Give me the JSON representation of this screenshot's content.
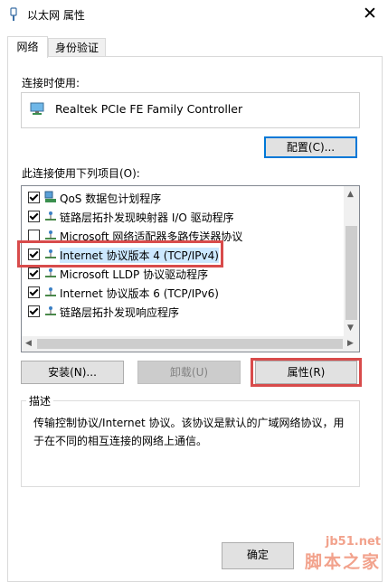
{
  "window": {
    "title": "以太网 属性",
    "close_label": "✕"
  },
  "tabs": [
    {
      "label": "网络",
      "active": true
    },
    {
      "label": "身份验证",
      "active": false
    }
  ],
  "connect_using": {
    "label": "连接时使用:",
    "device_name": "Realtek PCIe FE Family Controller",
    "configure_label": "配置(C)..."
  },
  "items_section": {
    "label": "此连接使用下列项目(O):",
    "items": [
      {
        "label": "QoS 数据包计划程序",
        "checked": true,
        "icon": "network-service-icon"
      },
      {
        "label": "链路层拓扑发现映射器 I/O 驱动程序",
        "checked": true,
        "icon": "protocol-icon"
      },
      {
        "label": "Microsoft 网络适配器多路传送器协议",
        "checked": false,
        "icon": "protocol-icon"
      },
      {
        "label": "Internet 协议版本 4 (TCP/IPv4)",
        "checked": true,
        "icon": "protocol-icon",
        "selected": true
      },
      {
        "label": "Microsoft LLDP 协议驱动程序",
        "checked": true,
        "icon": "protocol-icon"
      },
      {
        "label": "Internet 协议版本 6 (TCP/IPv6)",
        "checked": true,
        "icon": "protocol-icon"
      },
      {
        "label": "链路层拓扑发现响应程序",
        "checked": true,
        "icon": "protocol-icon"
      }
    ]
  },
  "buttons": {
    "install": "安装(N)...",
    "uninstall": "卸载(U)",
    "properties": "属性(R)",
    "ok": "确定"
  },
  "description": {
    "label": "描述",
    "text": "传输控制协议/Internet 协议。该协议是默认的广域网络协议，用于在不同的相互连接的网络上通信。"
  },
  "watermark": {
    "url": "jb51.net",
    "name": "脚本之家"
  },
  "colors": {
    "highlight": "#d84b4b",
    "selection": "#cce8ff",
    "focus_border": "#0078d7"
  }
}
